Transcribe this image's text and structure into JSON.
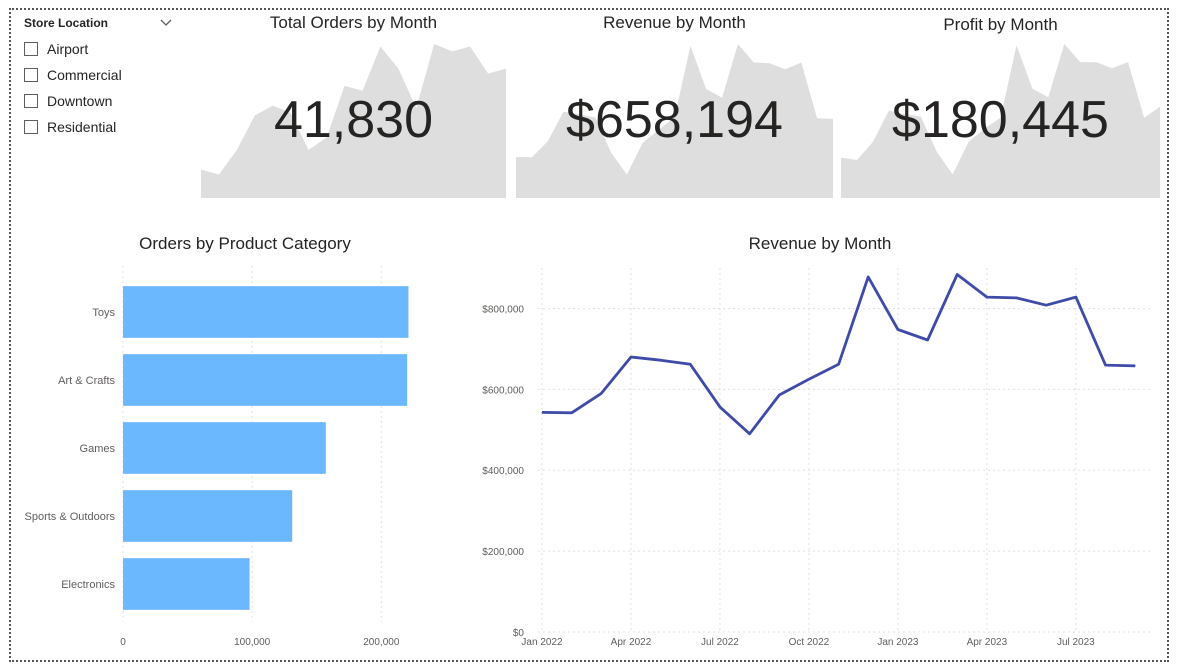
{
  "slicer": {
    "title": "Store Location",
    "items": [
      {
        "label": "Airport",
        "checked": false
      },
      {
        "label": "Commercial",
        "checked": false
      },
      {
        "label": "Downtown",
        "checked": false
      },
      {
        "label": "Residential",
        "checked": false
      }
    ]
  },
  "kpi_cards": [
    {
      "title": "Total Orders by Month",
      "value": "41,830",
      "sparkline": [
        1300,
        1100,
        2100,
        3500,
        3900,
        3600,
        2100,
        2600,
        4700,
        4500,
        6300,
        5400,
        3800,
        6400,
        6100,
        6300,
        5200,
        5400
      ]
    },
    {
      "title": "Revenue by Month",
      "value": "$658,194",
      "sparkline": [
        543000,
        542000,
        590000,
        680000,
        672000,
        662000,
        556000,
        490000,
        586000,
        625000,
        662000,
        878000,
        748000,
        722000,
        884000,
        828000,
        826000,
        808000,
        828000,
        660000,
        658000
      ]
    },
    {
      "title": "Profit by Month",
      "value": "$180,445",
      "sparkline": [
        148000,
        146000,
        161000,
        187000,
        184000,
        182000,
        153000,
        134000,
        161000,
        172000,
        181000,
        241000,
        205000,
        198000,
        242000,
        227000,
        227000,
        222000,
        227000,
        181000,
        190000
      ]
    }
  ],
  "chart_data": [
    {
      "type": "bar",
      "orientation": "horizontal",
      "title": "Orders by Product Category",
      "categories": [
        "Toys",
        "Art & Crafts",
        "Games",
        "Sports & Outdoors",
        "Electronics"
      ],
      "values": [
        221000,
        220000,
        157000,
        131000,
        98000
      ],
      "xlim": [
        0,
        240000
      ],
      "ticks": [
        "0",
        "100,000",
        "200,000"
      ],
      "tick_values": [
        0,
        100000,
        200000
      ],
      "color": "#6cb8ff",
      "grid": true
    },
    {
      "type": "line",
      "title": "Revenue by Month",
      "x": [
        "Jan 2022",
        "Feb 2022",
        "Mar 2022",
        "Apr 2022",
        "May 2022",
        "Jun 2022",
        "Jul 2022",
        "Aug 2022",
        "Sep 2022",
        "Oct 2022",
        "Nov 2022",
        "Dec 2022",
        "Jan 2023",
        "Feb 2023",
        "Mar 2023",
        "Apr 2023",
        "May 2023",
        "Jun 2023",
        "Jul 2023",
        "Aug 2023",
        "Sep 2023"
      ],
      "values": [
        543000,
        542000,
        590000,
        680000,
        672000,
        662000,
        556000,
        490000,
        586000,
        625000,
        662000,
        878000,
        748000,
        722000,
        884000,
        828000,
        826000,
        808000,
        828000,
        660000,
        658000
      ],
      "x_tick_labels": [
        "Jan 2022",
        "Apr 2022",
        "Jul 2022",
        "Oct 2022",
        "Jan 2023",
        "Apr 2023",
        "Jul 2023"
      ],
      "x_tick_index": [
        0,
        3,
        6,
        9,
        12,
        15,
        18
      ],
      "y_tick_labels": [
        "$0",
        "$200,000",
        "$400,000",
        "$600,000",
        "$800,000"
      ],
      "y_tick_values": [
        0,
        200000,
        400000,
        600000,
        800000
      ],
      "ylim": [
        0,
        900000
      ],
      "color": "#3f4ba8",
      "grid": true
    }
  ]
}
